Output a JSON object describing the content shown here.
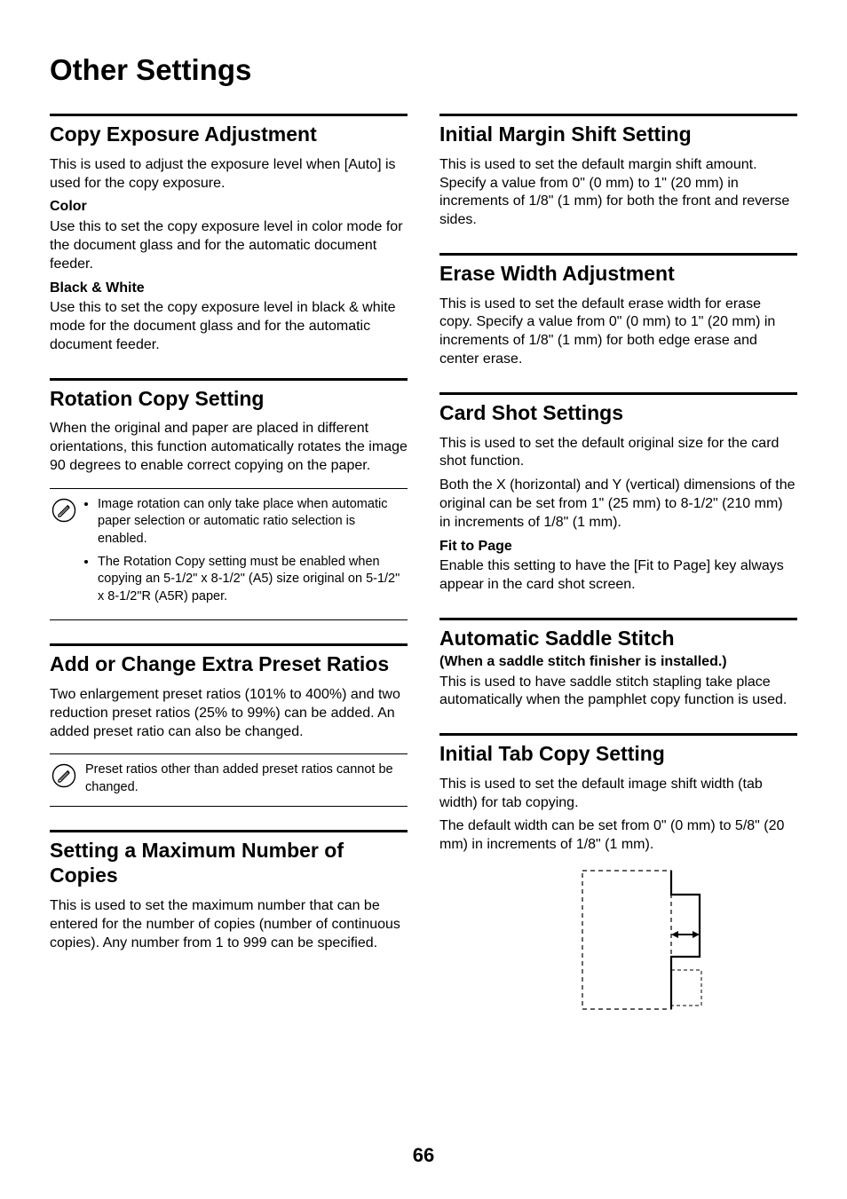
{
  "pageTitle": "Other Settings",
  "pageNumber": "66",
  "left": {
    "copyExposure": {
      "heading": "Copy Exposure Adjustment",
      "intro": "This is used to adjust the exposure level when [Auto] is used for the copy exposure.",
      "colorLabel": "Color",
      "colorBody": "Use this to set the copy exposure level in color mode for the document glass and for the automatic document feeder.",
      "bwLabel": "Black & White",
      "bwBody": "Use this to set the copy exposure level in black & white mode for the document glass and for the automatic document feeder."
    },
    "rotation": {
      "heading": "Rotation Copy Setting",
      "body": "When the original and paper are placed in different orientations, this function automatically rotates the image 90 degrees to enable correct copying on the paper.",
      "noteItem1": "Image rotation can only take place when automatic paper selection or automatic ratio selection is enabled.",
      "noteItem2": "The Rotation Copy setting must be enabled when copying an 5-1/2\" x 8-1/2\" (A5) size original on 5-1/2\" x 8-1/2\"R (A5R) paper."
    },
    "presetRatios": {
      "heading": "Add or Change Extra Preset Ratios",
      "body": "Two enlargement preset ratios (101% to 400%) and two reduction preset ratios (25% to 99%) can be added. An added preset ratio can also be changed.",
      "note": "Preset ratios other than added preset ratios cannot be changed."
    },
    "maxCopies": {
      "heading": "Setting a Maximum Number of Copies",
      "body": "This is used to set the maximum number that can be entered for the number of copies (number of continuous copies). Any number from 1 to 999 can be specified."
    }
  },
  "right": {
    "marginShift": {
      "heading": "Initial Margin Shift Setting",
      "body": "This is used to set the default margin shift amount. Specify a value from 0\" (0 mm) to 1\" (20 mm) in increments of 1/8\" (1 mm) for both the front and reverse sides."
    },
    "eraseWidth": {
      "heading": "Erase Width Adjustment",
      "body": "This is used to set the default erase width for erase copy. Specify a value from 0\" (0 mm) to 1\" (20 mm) in increments of 1/8\" (1 mm) for both edge erase and center erase."
    },
    "cardShot": {
      "heading": "Card Shot Settings",
      "body1": "This is used to set the default original size for the card shot function.",
      "body2": "Both the X (horizontal) and Y (vertical) dimensions of the original can be set from 1\" (25 mm) to 8-1/2\" (210 mm) in increments of 1/8\" (1 mm).",
      "fitLabel": "Fit to Page",
      "fitBody": "Enable this setting to have the [Fit to Page] key always appear in the card shot screen."
    },
    "saddleStitch": {
      "heading": "Automatic Saddle Stitch",
      "sub": "(When a saddle stitch finisher is installed.)",
      "body": "This is used to have saddle stitch stapling take place automatically when the pamphlet copy function is used."
    },
    "tabCopy": {
      "heading": "Initial Tab Copy Setting",
      "body1": "This is used to set the default image shift width (tab width) for tab copying.",
      "body2": "The default width can be set from 0\" (0 mm) to 5/8\" (20 mm) in increments of 1/8\" (1 mm)."
    }
  }
}
